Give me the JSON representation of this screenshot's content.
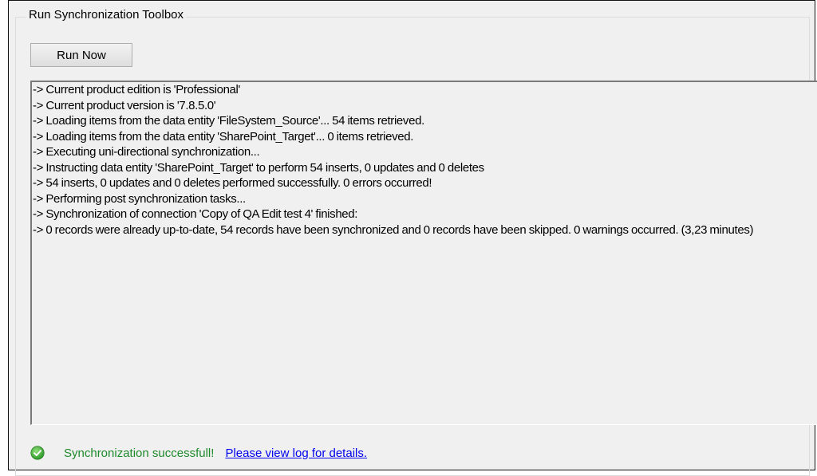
{
  "groupbox": {
    "title": "Run Synchronization Toolbox"
  },
  "toolbar": {
    "run_now_label": "Run Now"
  },
  "log": {
    "lines": [
      "-> Current product edition is 'Professional'",
      "-> Current product version is '7.8.5.0'",
      "-> Loading items from the data entity 'FileSystem_Source'... 54 items retrieved.",
      "-> Loading items from the data entity 'SharePoint_Target'... 0 items retrieved.",
      "-> Executing uni-directional synchronization...",
      "-> Instructing data entity 'SharePoint_Target' to perform 54 inserts, 0 updates and 0 deletes",
      "-> 54 inserts, 0 updates and 0 deletes performed successfully. 0 errors occurred!",
      "-> Performing post synchronization tasks...",
      "-> Synchronization of connection 'Copy of QA Edit test 4' finished:",
      "-> 0 records were already up-to-date, 54 records have been synchronized and 0 records have been skipped. 0 warnings occurred. (3,23 minutes)"
    ]
  },
  "status": {
    "icon": "success-check-icon",
    "message": "Synchronization successfull!",
    "link_label": "Please view log for details.",
    "success_color": "#1f8a2c",
    "link_color": "#0000ee"
  }
}
